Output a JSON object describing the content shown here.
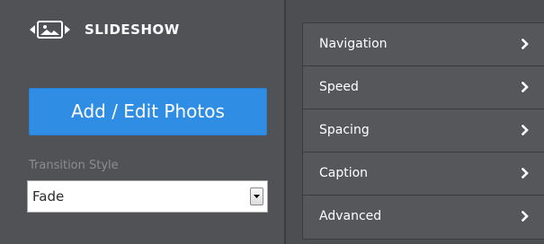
{
  "logo": {
    "text": "SLIDESHOW",
    "icon": "slideshow-logo-icon"
  },
  "add_button": {
    "label": "Add / Edit Photos"
  },
  "transition": {
    "label": "Transition Style",
    "selected": "Fade"
  },
  "menu": {
    "items": [
      {
        "label": "Navigation",
        "icon": "chevron-right-icon"
      },
      {
        "label": "Speed",
        "icon": "chevron-right-icon"
      },
      {
        "label": "Spacing",
        "icon": "chevron-right-icon"
      },
      {
        "label": "Caption",
        "icon": "chevron-right-icon"
      },
      {
        "label": "Advanced",
        "icon": "chevron-right-icon"
      }
    ]
  },
  "colors": {
    "panel_bg": "#505256",
    "button_blue": "#2f8de4",
    "menu_item_bg": "#55575b"
  }
}
